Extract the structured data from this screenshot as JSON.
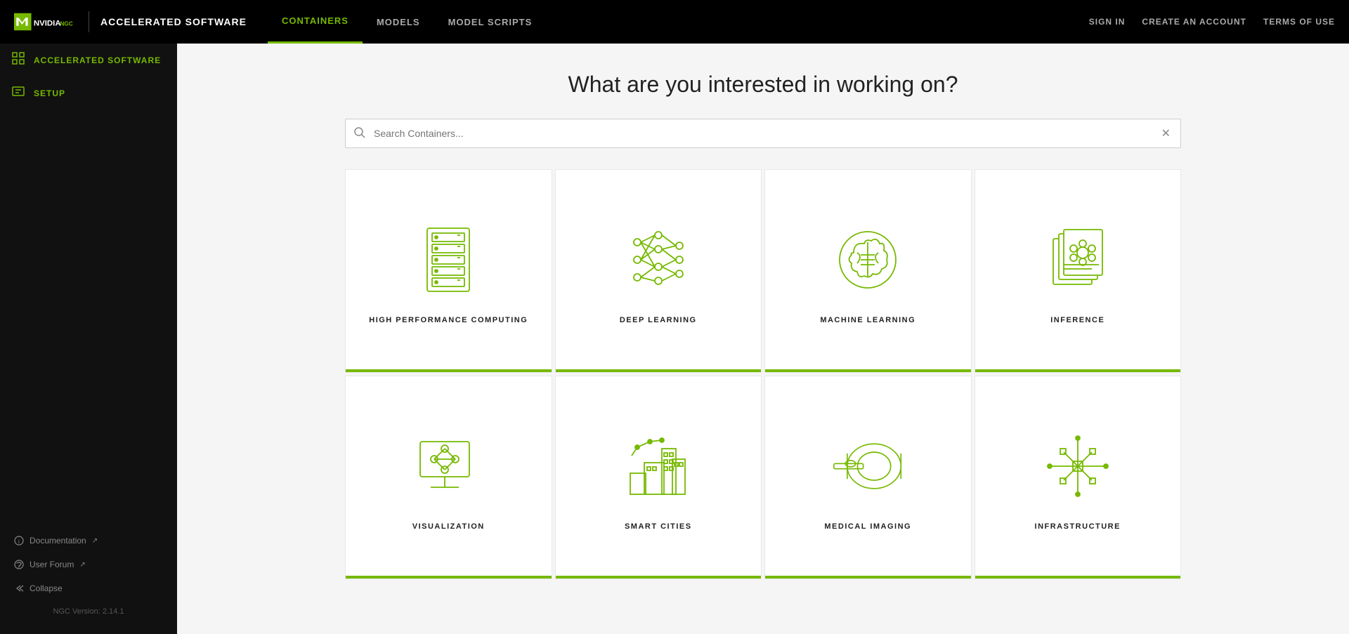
{
  "nav": {
    "brand": "ACCELERATED SOFTWARE",
    "links": [
      {
        "id": "containers",
        "label": "CONTAINERS",
        "active": true
      },
      {
        "id": "models",
        "label": "MODELS",
        "active": false
      },
      {
        "id": "model-scripts",
        "label": "MODEL SCRIPTS",
        "active": false
      }
    ],
    "right_links": [
      {
        "id": "sign-in",
        "label": "SIGN IN"
      },
      {
        "id": "create-account",
        "label": "CREATE AN ACCOUNT"
      },
      {
        "id": "terms",
        "label": "TERMS OF USE"
      }
    ]
  },
  "sidebar": {
    "top_item": {
      "label": "ACCELERATED SOFTWARE"
    },
    "setup_label": "SETUP",
    "bottom_links": [
      {
        "id": "documentation",
        "label": "Documentation"
      },
      {
        "id": "user-forum",
        "label": "User Forum"
      },
      {
        "id": "collapse",
        "label": "Collapse"
      }
    ],
    "version": "NGC Version: 2.14.1"
  },
  "main": {
    "title": "What are you interested in working on?",
    "search_placeholder": "Search Containers...",
    "cards": [
      {
        "id": "hpc",
        "label": "HIGH PERFORMANCE COMPUTING",
        "icon": "server"
      },
      {
        "id": "deep-learning",
        "label": "DEEP LEARNING",
        "icon": "neural-net"
      },
      {
        "id": "machine-learning",
        "label": "MACHINE LEARNING",
        "icon": "brain"
      },
      {
        "id": "inference",
        "label": "INFERENCE",
        "icon": "layers"
      },
      {
        "id": "visualization",
        "label": "VISUALIZATION",
        "icon": "monitor"
      },
      {
        "id": "smart-cities",
        "label": "SMART CITIES",
        "icon": "city"
      },
      {
        "id": "medical-imaging",
        "label": "MEDICAL IMAGING",
        "icon": "mri"
      },
      {
        "id": "infrastructure",
        "label": "INFRASTRUCTURE",
        "icon": "circuit"
      }
    ]
  }
}
